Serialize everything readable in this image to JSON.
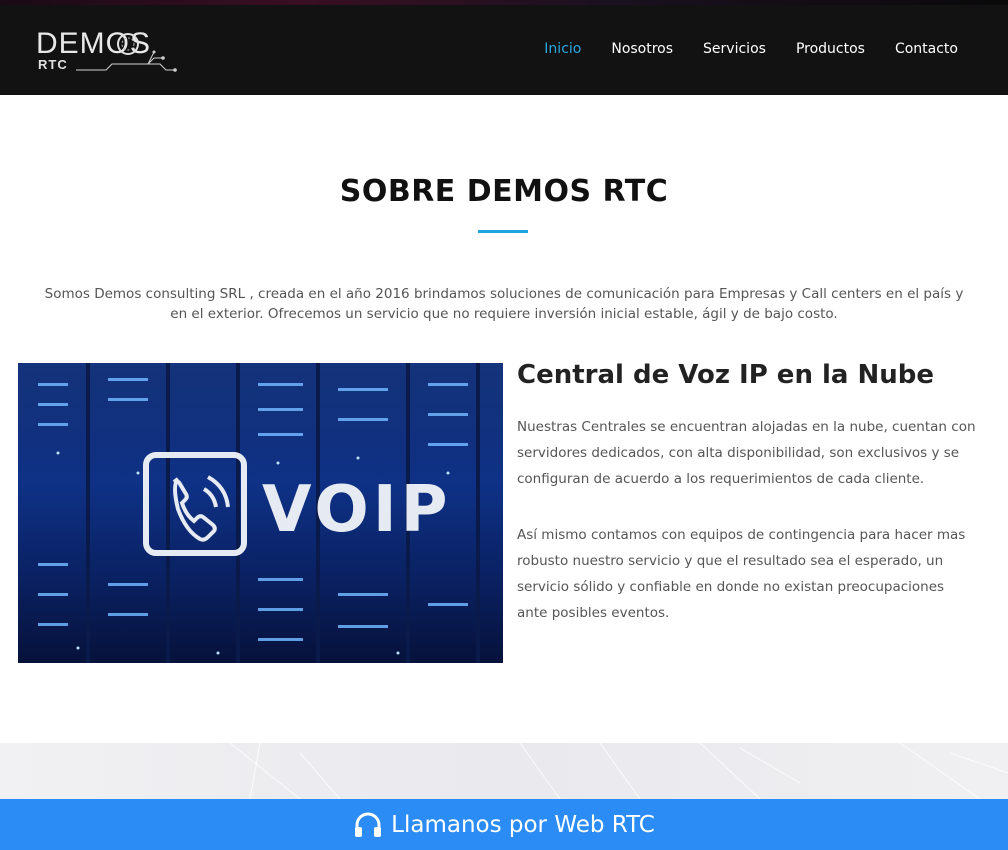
{
  "logo": {
    "name": "DEMOS",
    "sub": "RTC"
  },
  "nav": {
    "items": [
      {
        "label": "Inicio",
        "active": true
      },
      {
        "label": "Nosotros",
        "active": false
      },
      {
        "label": "Servicios",
        "active": false
      },
      {
        "label": "Productos",
        "active": false
      },
      {
        "label": "Contacto",
        "active": false
      }
    ]
  },
  "about": {
    "title": "SOBRE DEMOS RTC",
    "intro": "Somos Demos consulting SRL , creada en el año 2016 brindamos soluciones de comunicación para Empresas y Call centers en el país y en el exterior. Ofrecemos un servicio que no requiere inversión inicial estable, ágil y de bajo costo."
  },
  "feature": {
    "image_text": "VOIP",
    "heading": "Central de Voz IP en la Nube",
    "para1": "Nuestras Centrales se encuentran alojadas en la nube, cuentan con servidores dedicados, con alta disponibilidad, son exclusivos y se configuran de acuerdo a los requerimientos de cada cliente.",
    "para2": "Así mismo contamos con equipos de contingencia para hacer mas robusto nuestro servicio y que el resultado sea el esperado, un servicio sólido y confiable en donde no existan preocupaciones ante posibles eventos."
  },
  "cta": {
    "label": "Llamanos por Web RTC",
    "icon": "headphones-icon"
  },
  "colors": {
    "accent": "#1fa2e0",
    "cta": "#2b8cf5",
    "navbar": "#121212"
  }
}
